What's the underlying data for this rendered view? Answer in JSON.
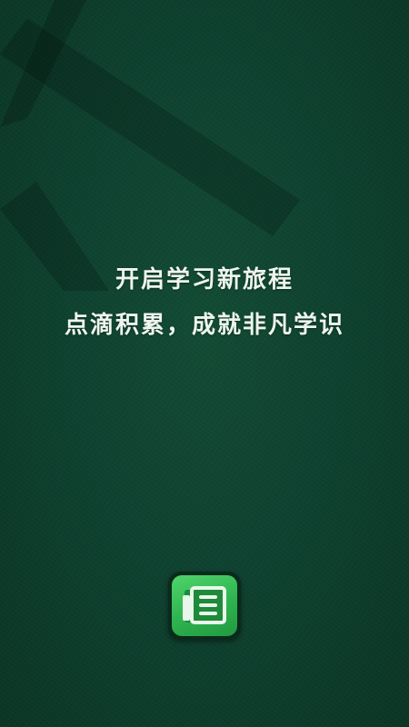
{
  "slogan": {
    "line1": "开启学习新旅程",
    "line2": "点滴积累，成就非凡学识"
  },
  "app_icon": {
    "icon": "newspaper-icon"
  },
  "colors": {
    "background": "#0f4230",
    "text": "#eef5ee",
    "icon_green": "#2fb350"
  }
}
